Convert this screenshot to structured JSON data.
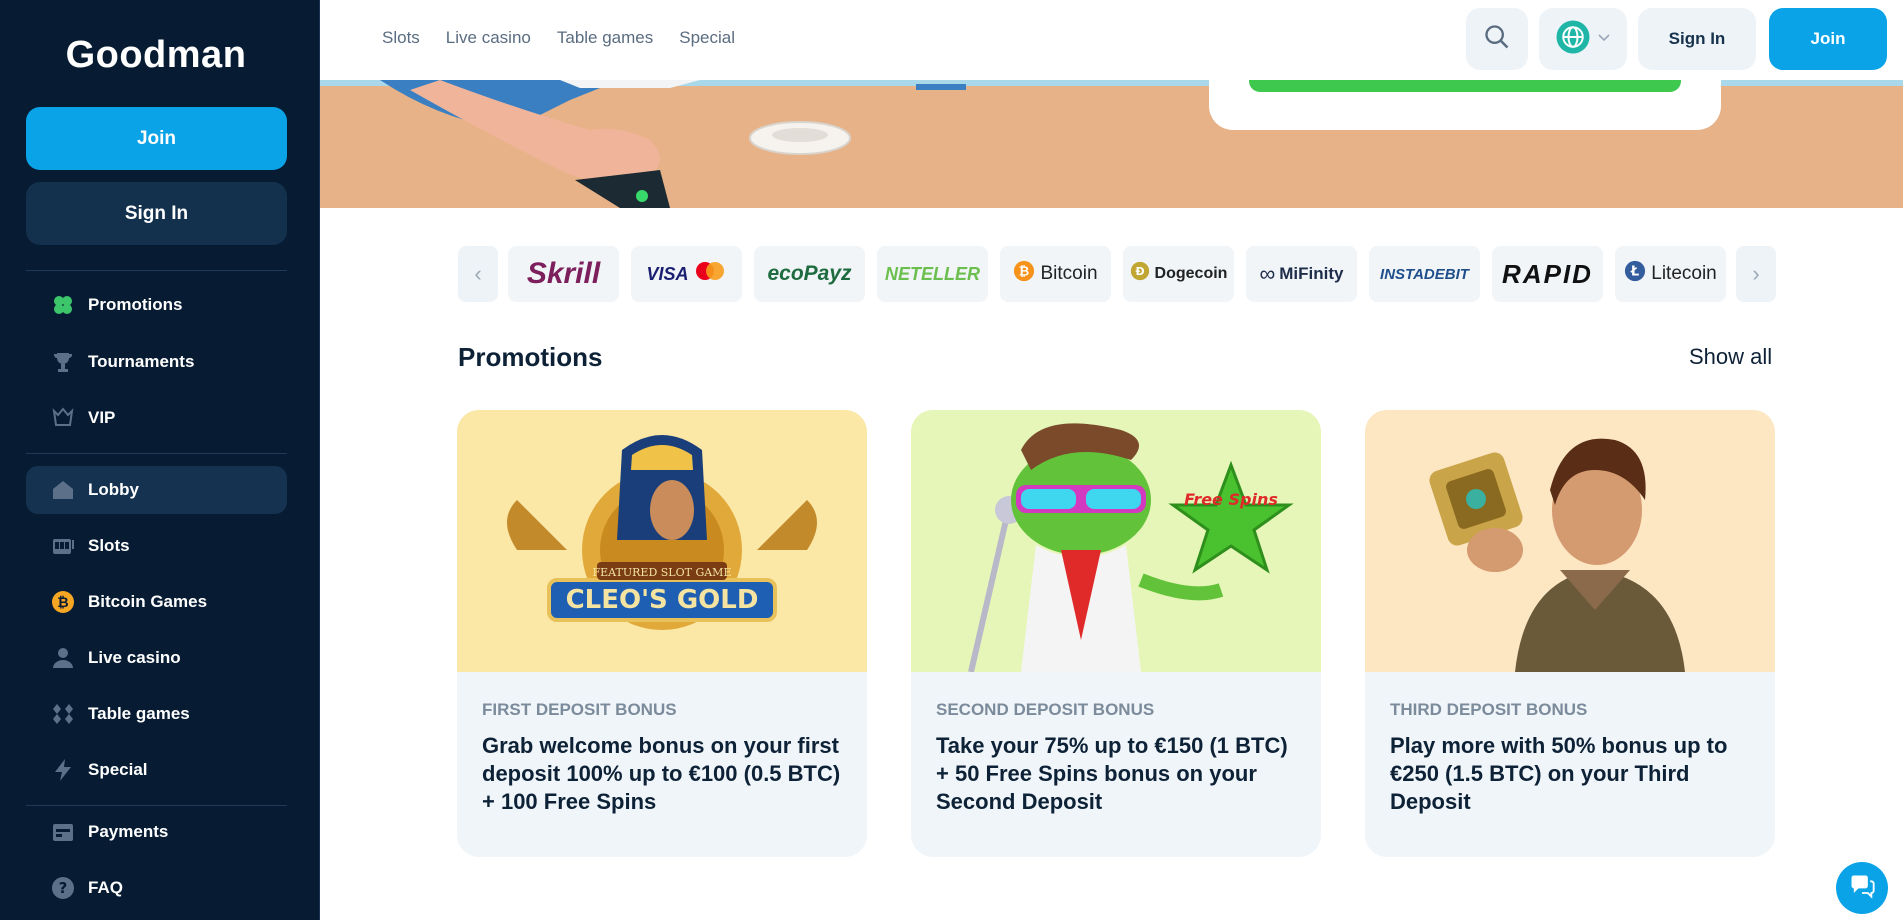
{
  "brand": {
    "logo_text": "Goodman"
  },
  "sidebar": {
    "join_label": "Join",
    "signin_label": "Sign In",
    "items": [
      {
        "label": "Promotions",
        "icon": "clover-icon"
      },
      {
        "label": "Tournaments",
        "icon": "trophy-icon"
      },
      {
        "label": "VIP",
        "icon": "vip-icon"
      },
      {
        "label": "Lobby",
        "icon": "home-icon",
        "active": true
      },
      {
        "label": "Slots",
        "icon": "slot-machine-icon"
      },
      {
        "label": "Bitcoin Games",
        "icon": "bitcoin-icon"
      },
      {
        "label": "Live casino",
        "icon": "dealer-icon"
      },
      {
        "label": "Table games",
        "icon": "cards-icon"
      },
      {
        "label": "Special",
        "icon": "lightning-icon"
      },
      {
        "label": "Payments",
        "icon": "wallet-icon"
      },
      {
        "label": "FAQ",
        "icon": "question-icon"
      }
    ]
  },
  "header": {
    "nav": [
      "Slots",
      "Live casino",
      "Table games",
      "Special"
    ],
    "signin_label": "Sign In",
    "join_label": "Join"
  },
  "payments": [
    "Skrill",
    "VISA",
    "ecoPayz",
    "NETELLER",
    "Bitcoin",
    "Dogecoin",
    "MiFinity",
    "INSTADEBIT",
    "RAPID",
    "Litecoin"
  ],
  "promotions": {
    "title": "Promotions",
    "show_all": "Show all",
    "cards": [
      {
        "tag": "FIRST DEPOSIT BONUS",
        "text": "Grab welcome bonus on your first deposit 100% up to €100 (0.5 BTC) + 100 Free Spins",
        "image_caption": "CLEO'S GOLD",
        "image_sub": "FEATURED SLOT GAME"
      },
      {
        "tag": "SECOND DEPOSIT BONUS",
        "text": "Take your 75% up to €150 (1 BTC) + 50 Free Spins bonus on your Second Deposit",
        "image_caption": "Free Spins"
      },
      {
        "tag": "THIRD DEPOSIT BONUS",
        "text": "Play more with 50% bonus up to €250 (1.5 BTC) on your Third Deposit"
      }
    ]
  },
  "colors": {
    "sidebar_bg": "#071c33",
    "accent": "#0aa3e8",
    "card_bg": "#f0f5f9"
  }
}
